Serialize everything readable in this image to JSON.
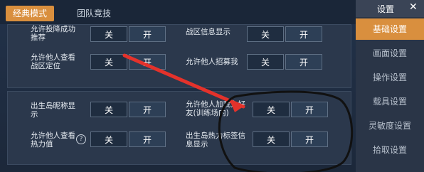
{
  "tabs": [
    {
      "label": "经典模式",
      "active": true
    },
    {
      "label": "团队竞技",
      "active": false
    }
  ],
  "right_panel": {
    "title": "设置",
    "close": "✕",
    "items": [
      {
        "label": "基础设置",
        "active": true
      },
      {
        "label": "画面设置",
        "active": false
      },
      {
        "label": "操作设置",
        "active": false
      },
      {
        "label": "载具设置",
        "active": false
      },
      {
        "label": "灵敏度设置",
        "active": false
      },
      {
        "label": "拾取设置",
        "active": false
      }
    ]
  },
  "toggle_labels": {
    "off": "关",
    "on": "开"
  },
  "settings": [
    {
      "label": "允许投降成功\n推荐",
      "state": "on"
    },
    {
      "label": "战区信息显示",
      "state": "on"
    },
    {
      "label": "允许他人查看\n战区定位",
      "state": "off"
    },
    {
      "label": "允许他人招募我",
      "state": "on"
    },
    {
      "label": "出生岛昵称显\n示",
      "state": "off"
    },
    {
      "label": "允许他人加我为好\n友(训练场内)",
      "state": "off"
    },
    {
      "label": "允许他人查看\n热力值",
      "state": "off"
    },
    {
      "label": "出生岛热力标签信\n息显示",
      "state": "off"
    }
  ],
  "info_icon": "?",
  "colors": {
    "accent": "#d98f3e",
    "arrow": "#e4322b",
    "circle": "#111111"
  }
}
